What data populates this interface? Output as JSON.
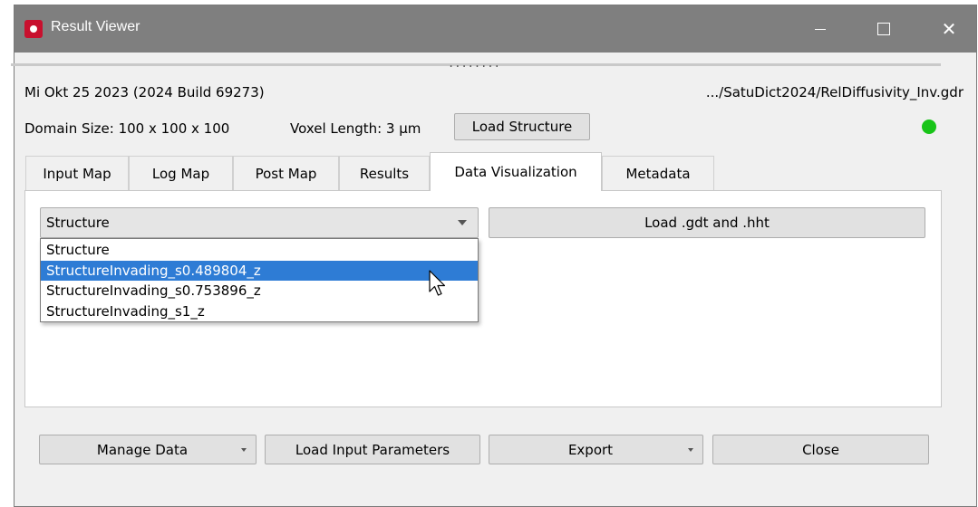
{
  "window": {
    "title": "Result Viewer"
  },
  "titlebar": {
    "minimize_icon": "minimize-icon",
    "maximize_icon": "maximize-icon",
    "close_icon": "close-icon",
    "close_glyph": "✕"
  },
  "info": {
    "date_build": "Mi Okt 25 2023 (2024 Build 69273)",
    "file_path": ".../SatuDict2024/RelDiffusivity_Inv.gdr",
    "domain_size": "Domain Size: 100 x 100 x 100",
    "voxel_length": "Voxel Length: 3 µm",
    "load_structure_label": "Load Structure",
    "status_color": "#18c418"
  },
  "splitter": {
    "grip": "........"
  },
  "tabs": [
    {
      "label": "Input Map"
    },
    {
      "label": "Log Map"
    },
    {
      "label": "Post Map"
    },
    {
      "label": "Results"
    },
    {
      "label": "Data Visualization",
      "active": true
    },
    {
      "label": "Metadata"
    }
  ],
  "visualization": {
    "combo_value": "Structure",
    "load_button_label": "Load .gdt and .hht",
    "options": [
      "Structure",
      "StructureInvading_s0.489804_z",
      "StructureInvading_s0.753896_z",
      "StructureInvading_s1_z"
    ],
    "highlighted_option": "StructureInvading_s0.489804_z"
  },
  "footer": {
    "manage_data_label": "Manage Data",
    "load_input_parameters_label": "Load Input Parameters",
    "export_label": "Export",
    "close_label": "Close"
  },
  "colors": {
    "titlebar": "#7f7f7f",
    "selection": "#2e7cd5",
    "accent_brand": "#c8102e"
  }
}
